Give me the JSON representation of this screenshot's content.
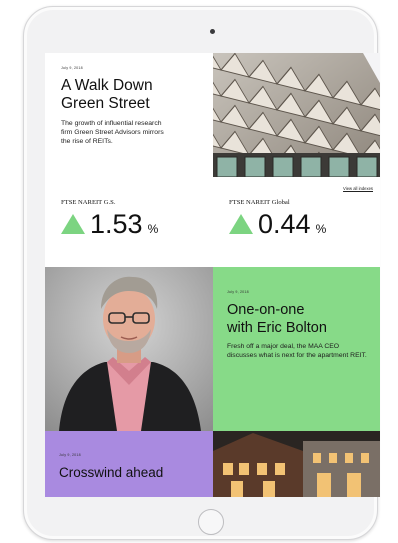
{
  "stories": {
    "walk": {
      "date": "July 9, 2018",
      "title_line1": "A Walk Down",
      "title_line2": "Green Street",
      "dek": "The growth of influential research firm Green Street Advisors mirrors the rise of REITs."
    },
    "bolton": {
      "date": "July 9, 2018",
      "title_line1": "One-on-one",
      "title_line2": "with Eric Bolton",
      "dek": "Fresh off a major deal, the MAA CEO discusses what is next for the apartment REIT."
    },
    "crosswind": {
      "date": "July 9, 2018",
      "title": "Crosswind ahead"
    }
  },
  "market": {
    "view_all": "View all indexes",
    "indexes": [
      {
        "label": "FTSE NAREIT G.S.",
        "value": "1.53",
        "unit": "%"
      },
      {
        "label": "FTSE NAREIT Global",
        "value": "0.44",
        "unit": "%"
      }
    ]
  },
  "colors": {
    "green": "#87da88",
    "purple": "#a98ae0",
    "up_arrow": "#7cd481"
  },
  "icons": [
    "camera-icon",
    "home-button-icon",
    "up-arrow-icon"
  ]
}
